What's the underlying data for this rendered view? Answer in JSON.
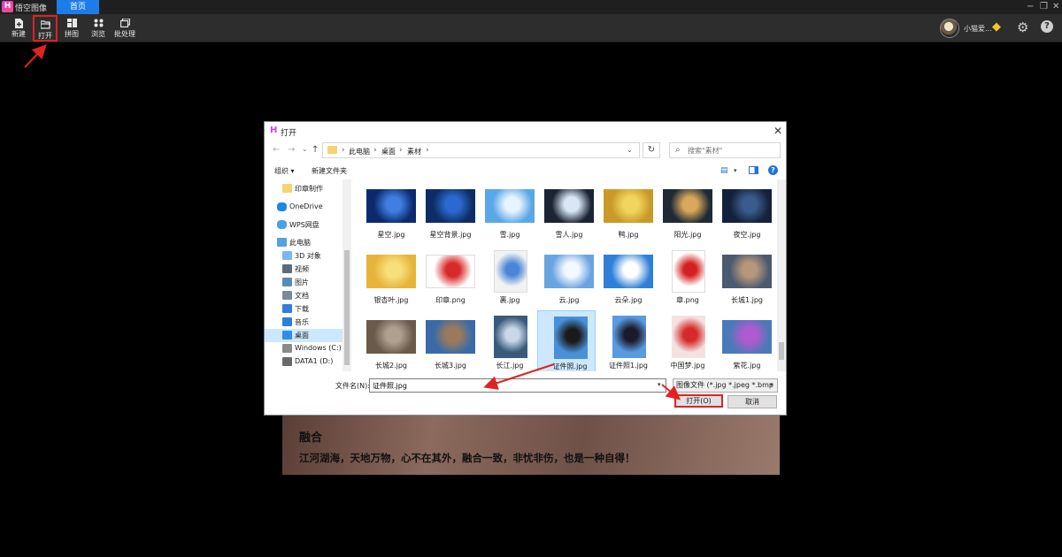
{
  "app": {
    "logo": "H",
    "name": "悟空图像",
    "tab": "首页",
    "window_controls": [
      "−",
      "❐",
      "✕"
    ]
  },
  "toolbar": {
    "items": [
      {
        "label": "新建",
        "icon": "new-file-icon"
      },
      {
        "label": "打开",
        "icon": "open-folder-icon"
      },
      {
        "label": "拼图",
        "icon": "collage-icon"
      },
      {
        "label": "浏览",
        "icon": "browse-icon"
      },
      {
        "label": "批处理",
        "icon": "batch-icon"
      }
    ],
    "user": {
      "name": "小猫爱...",
      "vip_icon": "◆",
      "settings_icon": "⚙",
      "help_icon": "?"
    }
  },
  "background_card": {
    "title": "融合",
    "text": "江河湖海，天地万物，心不在其外，融合一致，非忧非伤，也是一种自得！"
  },
  "dialog": {
    "logo": "H",
    "title": "打开",
    "close": "✕",
    "nav": {
      "back": "←",
      "forward": "→",
      "history": "⌄",
      "up": "↑"
    },
    "breadcrumb": [
      "此电脑",
      "桌面",
      "素材"
    ],
    "breadcrumb_sep": "›",
    "refresh": "↻",
    "search_placeholder": "搜索\"素材\"",
    "commands": {
      "organize": "组织 ▾",
      "new_folder": "新建文件夹",
      "view": "▤",
      "view_dd": "▾",
      "help": "?"
    },
    "sidebar": [
      {
        "label": "印章制作",
        "icon": "folder-icon",
        "color": "#f7d372"
      },
      {
        "label": "OneDrive",
        "icon": "onedrive-icon",
        "color": "#1e88e5"
      },
      {
        "label": "WPS网盘",
        "icon": "wps-cloud-icon",
        "color": "#4aa0e8"
      },
      {
        "label": "此电脑",
        "icon": "computer-icon",
        "color": "#5aa0e0"
      },
      {
        "label": "3D 对象",
        "icon": "3d-objects-icon",
        "color": "#7ab7f0"
      },
      {
        "label": "视频",
        "icon": "video-icon",
        "color": "#5a6b7e"
      },
      {
        "label": "图片",
        "icon": "pictures-icon",
        "color": "#5a8bb8"
      },
      {
        "label": "文档",
        "icon": "documents-icon",
        "color": "#7b8a9a"
      },
      {
        "label": "下载",
        "icon": "downloads-icon",
        "color": "#2f7fd8"
      },
      {
        "label": "音乐",
        "icon": "music-icon",
        "color": "#2f7fd8"
      },
      {
        "label": "桌面",
        "icon": "desktop-icon",
        "color": "#2f8fe8"
      },
      {
        "label": "Windows (C:)",
        "icon": "drive-c-icon",
        "color": "#8a8a8a"
      },
      {
        "label": "DATA1 (D:)",
        "icon": "drive-d-icon",
        "color": "#6a6a6a"
      }
    ],
    "selected_sidebar": "桌面",
    "files": [
      {
        "name": "星空.jpg",
        "color": "#0b2a6e",
        "accent": "#3f7fe0"
      },
      {
        "name": "星空背景.jpg",
        "color": "#0e2d66",
        "accent": "#2a6ad0"
      },
      {
        "name": "雪.jpg",
        "color": "#5aa7e8",
        "accent": "#e8f4ff"
      },
      {
        "name": "雪人.jpg",
        "color": "#1b2433",
        "accent": "#d8e6f5"
      },
      {
        "name": "鸭.jpg",
        "color": "#c99a2a",
        "accent": "#f1d65e"
      },
      {
        "name": "阳光.jpg",
        "color": "#1f2a36",
        "accent": "#d9a85a"
      },
      {
        "name": "夜空.jpg",
        "color": "#14213a",
        "accent": "#3a5b8c"
      },
      {
        "name": "银杏叶.jpg",
        "color": "#e6b43a",
        "accent": "#f7df7a"
      },
      {
        "name": "印章.png",
        "color": "#ffffff",
        "accent": "#d92a2a"
      },
      {
        "name": "裹.jpg",
        "color": "#f2f2f2",
        "accent": "#4a86d8"
      },
      {
        "name": "云.jpg",
        "color": "#6aa4e0",
        "accent": "#f4f8ff"
      },
      {
        "name": "云朵.jpg",
        "color": "#2f7fd8",
        "accent": "#ffffff"
      },
      {
        "name": "章.png",
        "color": "#ffffff",
        "accent": "#d42020"
      },
      {
        "name": "长城1.jpg",
        "color": "#4a5a70",
        "accent": "#b8967a"
      },
      {
        "name": "长城2.jpg",
        "color": "#6a5a4a",
        "accent": "#b0a090"
      },
      {
        "name": "长城3.jpg",
        "color": "#3a6aa8",
        "accent": "#9a7a5a"
      },
      {
        "name": "长江.jpg",
        "color": "#3a5a7a",
        "accent": "#c8d8e8"
      },
      {
        "name": "证件照.jpg",
        "color": "#4a90d8",
        "accent": "#1a1a1a"
      },
      {
        "name": "证件照1.jpg",
        "color": "#5a9ae0",
        "accent": "#1a1a2a"
      },
      {
        "name": "中国梦.jpg",
        "color": "#f4e2e2",
        "accent": "#d42a2a"
      },
      {
        "name": "紫花.jpg",
        "color": "#4a7ab8",
        "accent": "#b05ad0"
      }
    ],
    "selected_file": "证件照.jpg",
    "filename_label": "文件名(N):",
    "filename_value": "证件照.jpg",
    "filetype": "图像文件 (*.jpg *.jpeg *.bmp",
    "dd": "▾",
    "open_button": "打开(O)",
    "cancel_button": "取消"
  },
  "colors": {
    "accent": "#1e7ce8",
    "highlight": "#e02222"
  }
}
